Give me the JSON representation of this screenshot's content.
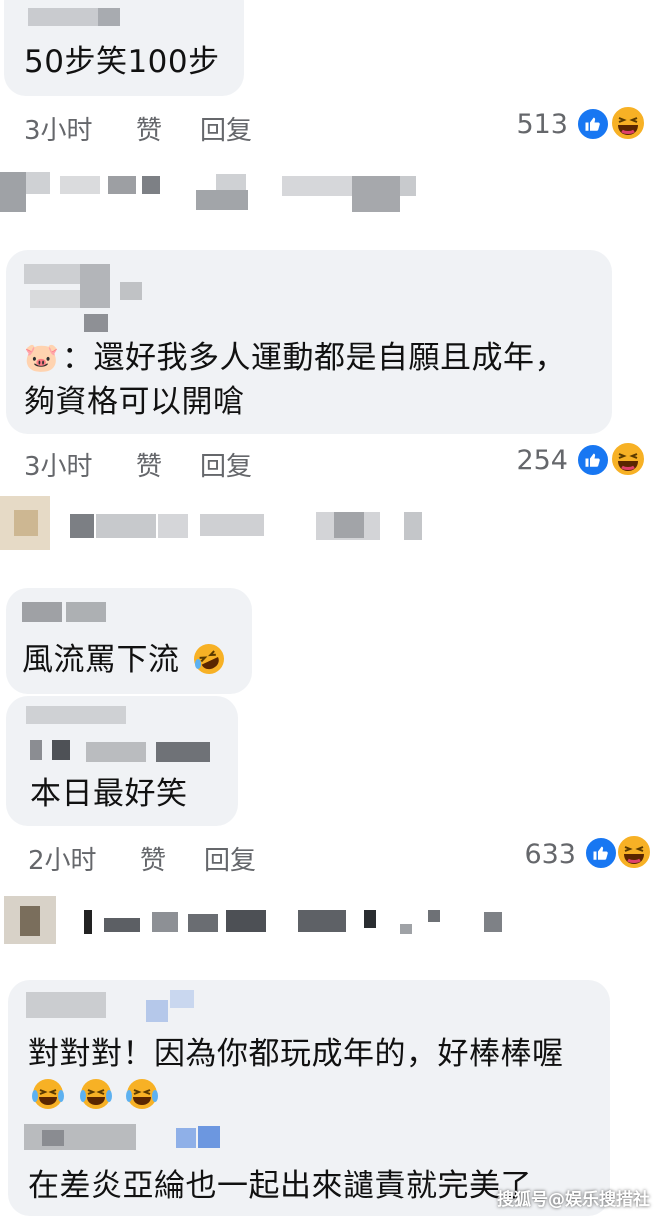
{
  "comments": [
    {
      "text": "50步笑100步",
      "time": "3小时",
      "like": "赞",
      "reply": "回复",
      "count": "513"
    },
    {
      "emoji": "🐷",
      "line1": "：還好我多人運動都是自願且成年，",
      "line2": "夠資格可以開嗆",
      "time": "3小时",
      "like": "赞",
      "reply": "回复",
      "count": "254"
    },
    {
      "text": "風流罵下流"
    },
    {
      "text": "本日最好笑",
      "time": "2小时",
      "like": "赞",
      "reply": "回复",
      "count": "633"
    },
    {
      "line1": "對對對！因為你都玩成年的，好棒棒喔"
    },
    {
      "text": "在差炎亞綸也一起出來譴責就完美了"
    }
  ],
  "watermark": "搜狐号@娱乐搜措社",
  "colors": {
    "bubble": "#f0f2f5",
    "meta": "#65676b",
    "like_blue": "#1877f2",
    "haha_yellow": "#f7b125"
  }
}
